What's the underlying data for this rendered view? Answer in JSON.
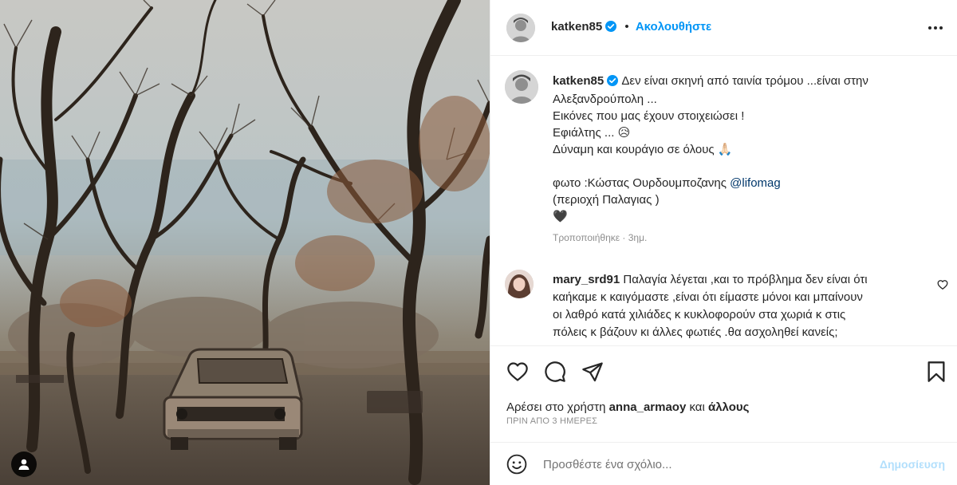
{
  "post": {
    "author": "katken85",
    "follow_label": "Ακολουθήστε",
    "separator": "•",
    "more_icon": "more-horizontal-icon"
  },
  "caption": {
    "username": "katken85",
    "lines": [
      "Δεν είναι σκηνή από ταινία τρόμου ...είναι στην",
      "Αλεξανδρούπολη ...",
      "Εικόνες που μας έχουν στοιχειώσει !",
      "Εφιάλτης ... 😥",
      "Δύναμη και κουράγιο σε όλους 🙏🏻",
      "",
      "φωτο :Κώστας Ουρδουμποζανης ",
      "(περιοχή Παλαγιας )",
      "🖤"
    ],
    "mention": "@lifomag",
    "meta": "Τροποποιήθηκε · 3ημ."
  },
  "comment": {
    "username": "mary_srd91",
    "text_lines": [
      " Παλαγία λέγεται ,και το πρόβλημα δεν είναι ότι",
      "καήκαμε κ καιγόμαστε ,είναι ότι είμαστε μόνοι και μπαίνουν",
      "οι λαθρό κατά χιλιάδες κ κυκλοφορούν στα χωριά κ στις",
      "πόλεις κ βάζουν κι άλλες φωτιές .θα ασχοληθεί κανείς;"
    ]
  },
  "likes": {
    "prefix": "Αρέσει στο χρήστη ",
    "user": "anna_armaoy",
    "middle": " και ",
    "others": "άλλους"
  },
  "timestamp": "ΠΡΙΝ ΑΠΟ 3 ΗΜΕΡΕΣ",
  "add_comment": {
    "placeholder": "Προσθέστε ένα σχόλιο...",
    "post_label": "Δημοσίευση"
  },
  "colors": {
    "accent": "#0095f6",
    "mention": "#00376b",
    "muted": "#8e8e8e",
    "post_disabled": "#b2dffc"
  }
}
